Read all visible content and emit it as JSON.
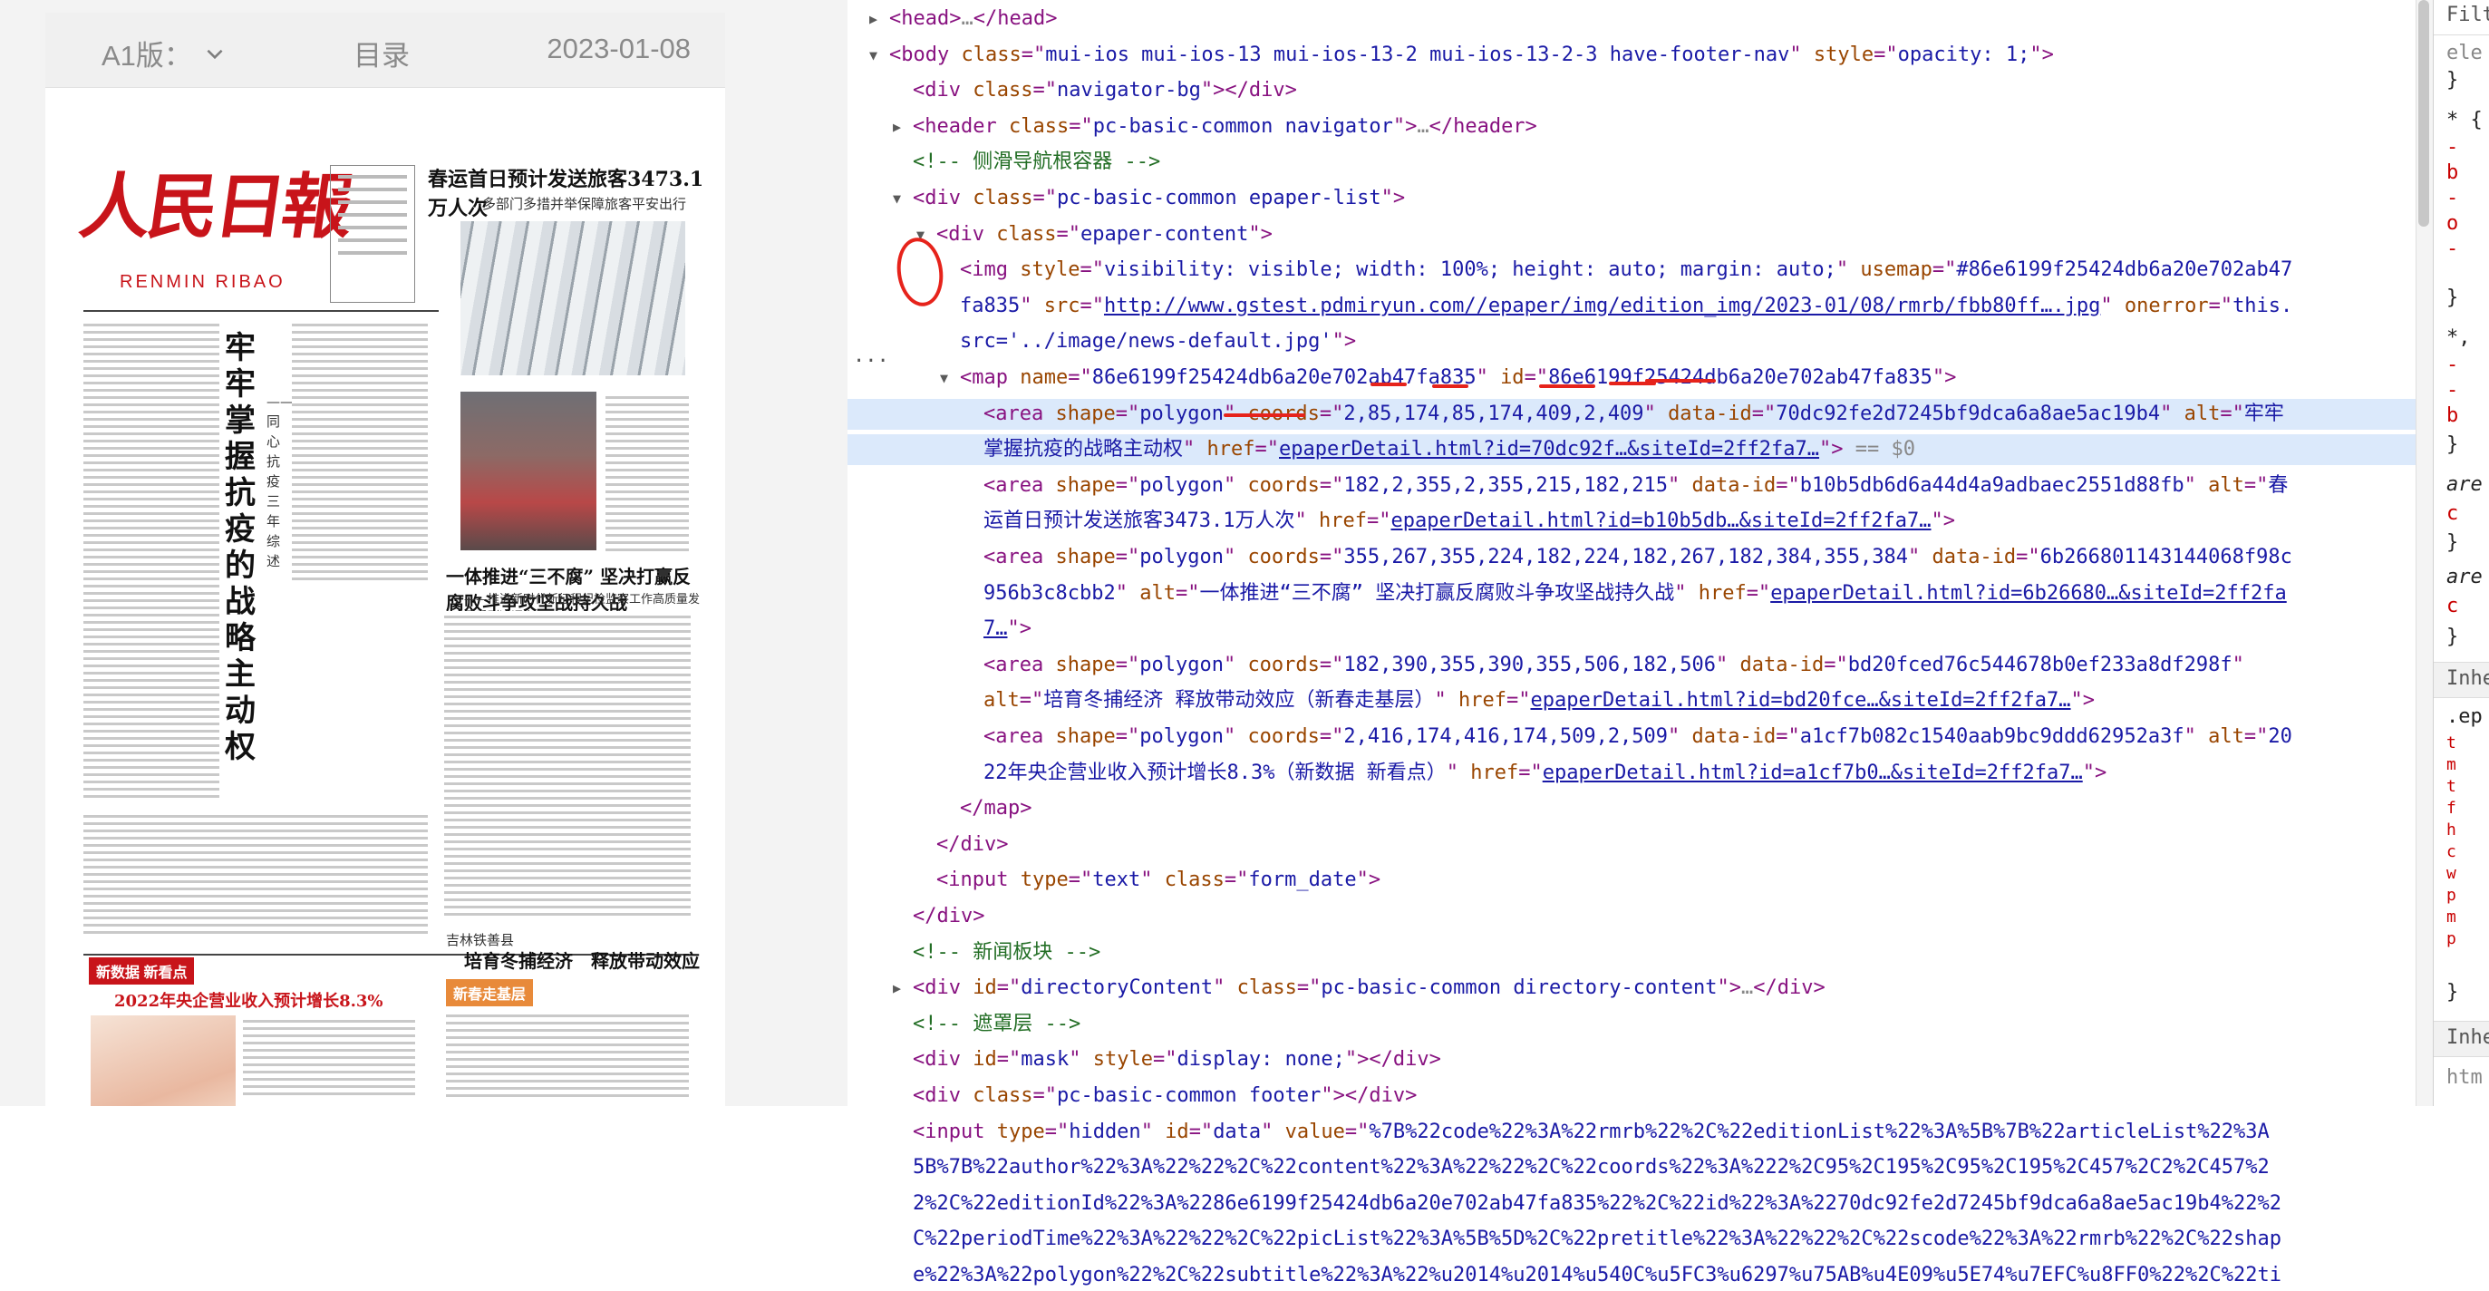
{
  "phone": {
    "edition_label": "A1版：",
    "toc_label": "目录",
    "date": "2023-01-08"
  },
  "newspaper": {
    "masthead": "人民日報",
    "masthead_roman": "RENMIN RIBAO",
    "lead_headline": "春运首日预计发送旅客3473.1万人次",
    "lead_subheadline": "多部门多措并举保障旅客平安出行",
    "vertical_headline": "牢牢掌握抗疫的战略主动权",
    "vertical_subheadline": "——同心抗疫三年综述",
    "second_headline": "一体推进“三不腐” 坚决打赢反腐败斗争攻坚战持久战",
    "second_subheadline": "——推进新时代新征程纪检监察工作高质量发展系列述评之三",
    "bottom_right_kicker": "吉林铁善县",
    "bottom_right_headline": "培育冬捕经济　释放带动效应",
    "bottom_left_tag": "新数据 新看点",
    "bottom_left_headline": "2022年央企营业收入预计增长8.3%",
    "bottom_right_tag": "新春走基层"
  },
  "devtools": {
    "lines": [
      {
        "t": "▶",
        "i": 0,
        "segs": [
          [
            "tag",
            "<head>"
          ],
          [
            "dim",
            "…"
          ],
          [
            "tag",
            "</head>"
          ]
        ]
      },
      {
        "t": "▼",
        "i": 0,
        "segs": [
          [
            "tag",
            "<body "
          ],
          [
            "att",
            "class"
          ],
          [
            "tag",
            "=\""
          ],
          [
            "val",
            "mui-ios mui-ios-13 mui-ios-13-2 mui-ios-13-2-3 have-footer-nav"
          ],
          [
            "tag",
            "\" "
          ],
          [
            "att",
            "style"
          ],
          [
            "tag",
            "=\""
          ],
          [
            "val",
            "opacity: 1;"
          ],
          [
            "tag",
            "\">"
          ]
        ]
      },
      {
        "t": "",
        "i": 1,
        "segs": [
          [
            "tag",
            "<div "
          ],
          [
            "att",
            "class"
          ],
          [
            "tag",
            "=\""
          ],
          [
            "val",
            "navigator-bg"
          ],
          [
            "tag",
            "\"></div>"
          ]
        ]
      },
      {
        "t": "▶",
        "i": 1,
        "segs": [
          [
            "tag",
            "<header "
          ],
          [
            "att",
            "class"
          ],
          [
            "tag",
            "=\""
          ],
          [
            "val",
            "pc-basic-common navigator"
          ],
          [
            "tag",
            "\">"
          ],
          [
            "dim",
            "…"
          ],
          [
            "tag",
            "</header>"
          ]
        ]
      },
      {
        "t": "",
        "i": 1,
        "segs": [
          [
            "cmt",
            "<!-- 侧滑导航根容器 -->"
          ]
        ]
      },
      {
        "t": "▼",
        "i": 1,
        "segs": [
          [
            "tag",
            "<div "
          ],
          [
            "att",
            "class"
          ],
          [
            "tag",
            "=\""
          ],
          [
            "val",
            "pc-basic-common epaper-list"
          ],
          [
            "tag",
            "\">"
          ]
        ]
      },
      {
        "t": "▼",
        "i": 2,
        "segs": [
          [
            "tag",
            "<div "
          ],
          [
            "att",
            "class"
          ],
          [
            "tag",
            "=\""
          ],
          [
            "val",
            "epaper-content"
          ],
          [
            "tag",
            "\">"
          ]
        ]
      },
      {
        "t": "",
        "i": 3,
        "segs": [
          [
            "tag",
            "<img "
          ],
          [
            "att",
            "style"
          ],
          [
            "tag",
            "=\""
          ],
          [
            "val",
            "visibility: visible; width: 100%; height: auto; margin: auto;"
          ],
          [
            "tag",
            "\" "
          ],
          [
            "att",
            "usemap"
          ],
          [
            "tag",
            "=\""
          ],
          [
            "val",
            "#86e6199f25424db6a20e702ab47"
          ]
        ]
      },
      {
        "t": "",
        "i": 3,
        "segs": [
          [
            "val",
            "fa835"
          ],
          [
            "tag",
            "\" "
          ],
          [
            "att",
            "src"
          ],
          [
            "tag",
            "=\""
          ],
          [
            "lnk",
            "http://www.gstest.pdmiryun.com//epaper/img/edition_img/2023-01/08/rmrb/fbb80ff….jpg"
          ],
          [
            "tag",
            "\" "
          ],
          [
            "att",
            "onerror"
          ],
          [
            "tag",
            "=\""
          ],
          [
            "val",
            "this."
          ]
        ]
      },
      {
        "t": "",
        "i": 3,
        "segs": [
          [
            "val",
            "src='../image/news-default.jpg'"
          ],
          [
            "tag",
            "\">"
          ]
        ]
      },
      {
        "t": "▼",
        "i": 3,
        "segs": [
          [
            "tag",
            "<map "
          ],
          [
            "att",
            "name"
          ],
          [
            "tag",
            "=\""
          ],
          [
            "val",
            "86e6199f25424db6a20e702ab47fa835"
          ],
          [
            "tag",
            "\" "
          ],
          [
            "att",
            "id"
          ],
          [
            "tag",
            "=\""
          ],
          [
            "val",
            "86e6199f25424db6a20e702ab47fa835"
          ],
          [
            "tag",
            "\">"
          ]
        ]
      },
      {
        "t": "",
        "i": 4,
        "sel": true,
        "segs": [
          [
            "tag",
            "<area "
          ],
          [
            "att",
            "shape"
          ],
          [
            "tag",
            "=\""
          ],
          [
            "val",
            "polygon"
          ],
          [
            "tag",
            "\" "
          ],
          [
            "att",
            "coords"
          ],
          [
            "tag",
            "=\""
          ],
          [
            "val",
            "2,85,174,85,174,409,2,409"
          ],
          [
            "tag",
            "\" "
          ],
          [
            "att",
            "data-id"
          ],
          [
            "tag",
            "=\""
          ],
          [
            "val",
            "70dc92fe2d7245bf9dca6a8ae5ac19b4"
          ],
          [
            "tag",
            "\" "
          ],
          [
            "att",
            "alt"
          ],
          [
            "tag",
            "=\""
          ],
          [
            "val",
            "牢牢"
          ]
        ]
      },
      {
        "t": "",
        "i": 4,
        "sel": true,
        "segs": [
          [
            "val",
            "掌握抗疫的战略主动权"
          ],
          [
            "tag",
            "\" "
          ],
          [
            "att",
            "href"
          ],
          [
            "tag",
            "=\""
          ],
          [
            "lnk",
            "epaperDetail.html?id=70dc92f…&siteId=2ff2fa7…"
          ],
          [
            "tag",
            "\">"
          ],
          [
            "dim",
            " == $0"
          ]
        ]
      },
      {
        "t": "",
        "i": 4,
        "segs": [
          [
            "tag",
            "<area "
          ],
          [
            "att",
            "shape"
          ],
          [
            "tag",
            "=\""
          ],
          [
            "val",
            "polygon"
          ],
          [
            "tag",
            "\" "
          ],
          [
            "att",
            "coords"
          ],
          [
            "tag",
            "=\""
          ],
          [
            "val",
            "182,2,355,2,355,215,182,215"
          ],
          [
            "tag",
            "\" "
          ],
          [
            "att",
            "data-id"
          ],
          [
            "tag",
            "=\""
          ],
          [
            "val",
            "b10b5db6d6a44d4a9adbaec2551d88fb"
          ],
          [
            "tag",
            "\" "
          ],
          [
            "att",
            "alt"
          ],
          [
            "tag",
            "=\""
          ],
          [
            "val",
            "春"
          ]
        ]
      },
      {
        "t": "",
        "i": 4,
        "segs": [
          [
            "val",
            "运首日预计发送旅客3473.1万人次"
          ],
          [
            "tag",
            "\" "
          ],
          [
            "att",
            "href"
          ],
          [
            "tag",
            "=\""
          ],
          [
            "lnk",
            "epaperDetail.html?id=b10b5db…&siteId=2ff2fa7…"
          ],
          [
            "tag",
            "\">"
          ]
        ]
      },
      {
        "t": "",
        "i": 4,
        "segs": [
          [
            "tag",
            "<area "
          ],
          [
            "att",
            "shape"
          ],
          [
            "tag",
            "=\""
          ],
          [
            "val",
            "polygon"
          ],
          [
            "tag",
            "\" "
          ],
          [
            "att",
            "coords"
          ],
          [
            "tag",
            "=\""
          ],
          [
            "val",
            "355,267,355,224,182,224,182,267,182,384,355,384"
          ],
          [
            "tag",
            "\" "
          ],
          [
            "att",
            "data-id"
          ],
          [
            "tag",
            "=\""
          ],
          [
            "val",
            "6b266801143144068f98c"
          ]
        ]
      },
      {
        "t": "",
        "i": 4,
        "segs": [
          [
            "val",
            "956b3c8cbb2"
          ],
          [
            "tag",
            "\" "
          ],
          [
            "att",
            "alt"
          ],
          [
            "tag",
            "=\""
          ],
          [
            "val",
            "一体推进“三不腐” 坚决打赢反腐败斗争攻坚战持久战"
          ],
          [
            "tag",
            "\" "
          ],
          [
            "att",
            "href"
          ],
          [
            "tag",
            "=\""
          ],
          [
            "lnk",
            "epaperDetail.html?id=6b26680…&siteId=2ff2fa"
          ]
        ]
      },
      {
        "t": "",
        "i": 4,
        "segs": [
          [
            "lnk",
            "7…"
          ],
          [
            "tag",
            "\">"
          ]
        ]
      },
      {
        "t": "",
        "i": 4,
        "segs": [
          [
            "tag",
            "<area "
          ],
          [
            "att",
            "shape"
          ],
          [
            "tag",
            "=\""
          ],
          [
            "val",
            "polygon"
          ],
          [
            "tag",
            "\" "
          ],
          [
            "att",
            "coords"
          ],
          [
            "tag",
            "=\""
          ],
          [
            "val",
            "182,390,355,390,355,506,182,506"
          ],
          [
            "tag",
            "\" "
          ],
          [
            "att",
            "data-id"
          ],
          [
            "tag",
            "=\""
          ],
          [
            "val",
            "bd20fced76c544678b0ef233a8df298f"
          ],
          [
            "tag",
            "\""
          ]
        ]
      },
      {
        "t": "",
        "i": 4,
        "segs": [
          [
            "att",
            "alt"
          ],
          [
            "tag",
            "=\""
          ],
          [
            "val",
            "培育冬捕经济 释放带动效应（新春走基层）"
          ],
          [
            "tag",
            "\" "
          ],
          [
            "att",
            "href"
          ],
          [
            "tag",
            "=\""
          ],
          [
            "lnk",
            "epaperDetail.html?id=bd20fce…&siteId=2ff2fa7…"
          ],
          [
            "tag",
            "\">"
          ]
        ]
      },
      {
        "t": "",
        "i": 4,
        "segs": [
          [
            "tag",
            "<area "
          ],
          [
            "att",
            "shape"
          ],
          [
            "tag",
            "=\""
          ],
          [
            "val",
            "polygon"
          ],
          [
            "tag",
            "\" "
          ],
          [
            "att",
            "coords"
          ],
          [
            "tag",
            "=\""
          ],
          [
            "val",
            "2,416,174,416,174,509,2,509"
          ],
          [
            "tag",
            "\" "
          ],
          [
            "att",
            "data-id"
          ],
          [
            "tag",
            "=\""
          ],
          [
            "val",
            "a1cf7b082c1540aab9bc9ddd62952a3f"
          ],
          [
            "tag",
            "\" "
          ],
          [
            "att",
            "alt"
          ],
          [
            "tag",
            "=\""
          ],
          [
            "val",
            "20"
          ]
        ]
      },
      {
        "t": "",
        "i": 4,
        "segs": [
          [
            "val",
            "22年央企营业收入预计增长8.3%（新数据 新看点）"
          ],
          [
            "tag",
            "\" "
          ],
          [
            "att",
            "href"
          ],
          [
            "tag",
            "=\""
          ],
          [
            "lnk",
            "epaperDetail.html?id=a1cf7b0…&siteId=2ff2fa7…"
          ],
          [
            "tag",
            "\">"
          ]
        ]
      },
      {
        "t": "",
        "i": 3,
        "segs": [
          [
            "tag",
            "</map>"
          ]
        ]
      },
      {
        "t": "",
        "i": 2,
        "segs": [
          [
            "tag",
            "</div>"
          ]
        ]
      },
      {
        "t": "",
        "i": 2,
        "segs": [
          [
            "tag",
            "<input "
          ],
          [
            "att",
            "type"
          ],
          [
            "tag",
            "=\""
          ],
          [
            "val",
            "text"
          ],
          [
            "tag",
            "\" "
          ],
          [
            "att",
            "class"
          ],
          [
            "tag",
            "=\""
          ],
          [
            "val",
            "form_date"
          ],
          [
            "tag",
            "\">"
          ]
        ]
      },
      {
        "t": "",
        "i": 1,
        "segs": [
          [
            "tag",
            "</div>"
          ]
        ]
      },
      {
        "t": "",
        "i": 1,
        "segs": [
          [
            "cmt",
            "<!-- 新闻板块 -->"
          ]
        ]
      },
      {
        "t": "▶",
        "i": 1,
        "segs": [
          [
            "tag",
            "<div "
          ],
          [
            "att",
            "id"
          ],
          [
            "tag",
            "=\""
          ],
          [
            "val",
            "directoryContent"
          ],
          [
            "tag",
            "\" "
          ],
          [
            "att",
            "class"
          ],
          [
            "tag",
            "=\""
          ],
          [
            "val",
            "pc-basic-common directory-content"
          ],
          [
            "tag",
            "\">"
          ],
          [
            "dim",
            "…"
          ],
          [
            "tag",
            "</div>"
          ]
        ]
      },
      {
        "t": "",
        "i": 1,
        "segs": [
          [
            "cmt",
            "<!-- 遮罩层 -->"
          ]
        ]
      },
      {
        "t": "",
        "i": 1,
        "segs": [
          [
            "tag",
            "<div "
          ],
          [
            "att",
            "id"
          ],
          [
            "tag",
            "=\""
          ],
          [
            "val",
            "mask"
          ],
          [
            "tag",
            "\" "
          ],
          [
            "att",
            "style"
          ],
          [
            "tag",
            "=\""
          ],
          [
            "val",
            "display: none;"
          ],
          [
            "tag",
            "\"></div>"
          ]
        ]
      },
      {
        "t": "",
        "i": 1,
        "segs": [
          [
            "tag",
            "<div "
          ],
          [
            "att",
            "class"
          ],
          [
            "tag",
            "=\""
          ],
          [
            "val",
            "pc-basic-common footer"
          ],
          [
            "tag",
            "\"></div>"
          ]
        ]
      },
      {
        "t": "",
        "i": 1,
        "segs": [
          [
            "tag",
            "<input "
          ],
          [
            "att",
            "type"
          ],
          [
            "tag",
            "=\""
          ],
          [
            "val",
            "hidden"
          ],
          [
            "tag",
            "\" "
          ],
          [
            "att",
            "id"
          ],
          [
            "tag",
            "=\""
          ],
          [
            "val",
            "data"
          ],
          [
            "tag",
            "\" "
          ],
          [
            "att",
            "value"
          ],
          [
            "tag",
            "=\""
          ],
          [
            "val",
            "%7B%22code%22%3A%22rmrb%22%2C%22editionList%22%3A%5B%7B%22articleList%22%3A"
          ]
        ]
      },
      {
        "t": "",
        "i": 1,
        "segs": [
          [
            "val",
            "5B%7B%22author%22%3A%22%22%2C%22content%22%3A%22%22%2C%22coords%22%3A%222%2C95%2C195%2C95%2C195%2C457%2C2%2C457%2"
          ]
        ]
      },
      {
        "t": "",
        "i": 1,
        "segs": [
          [
            "val",
            "2%2C%22editionId%22%3A%2286e6199f25424db6a20e702ab47fa835%22%2C%22id%22%3A%2270dc92fe2d7245bf9dca6a8ae5ac19b4%22%2"
          ]
        ]
      },
      {
        "t": "",
        "i": 1,
        "segs": [
          [
            "val",
            "C%22periodTime%22%3A%22%22%2C%22picList%22%3A%5B%5D%2C%22pretitle%22%3A%22%22%2C%22scode%22%3A%22rmrb%22%2C%22shap"
          ]
        ]
      },
      {
        "t": "",
        "i": 1,
        "segs": [
          [
            "val",
            "e%22%3A%22polygon%22%2C%22subtitle%22%3A%22%u2014%u2014%u540C%u5FC3%u6297%u75AB%u4E09%u5E74%u7EFC%u8FF0%22%2C%22ti"
          ]
        ]
      }
    ]
  },
  "styles_pane": {
    "filter": "Filte",
    "element_style": "ele",
    "inherited_1": "Inhe",
    "ep_selector": ".ep",
    "inherited_2": "Inhe",
    "html_selector": "htm"
  }
}
